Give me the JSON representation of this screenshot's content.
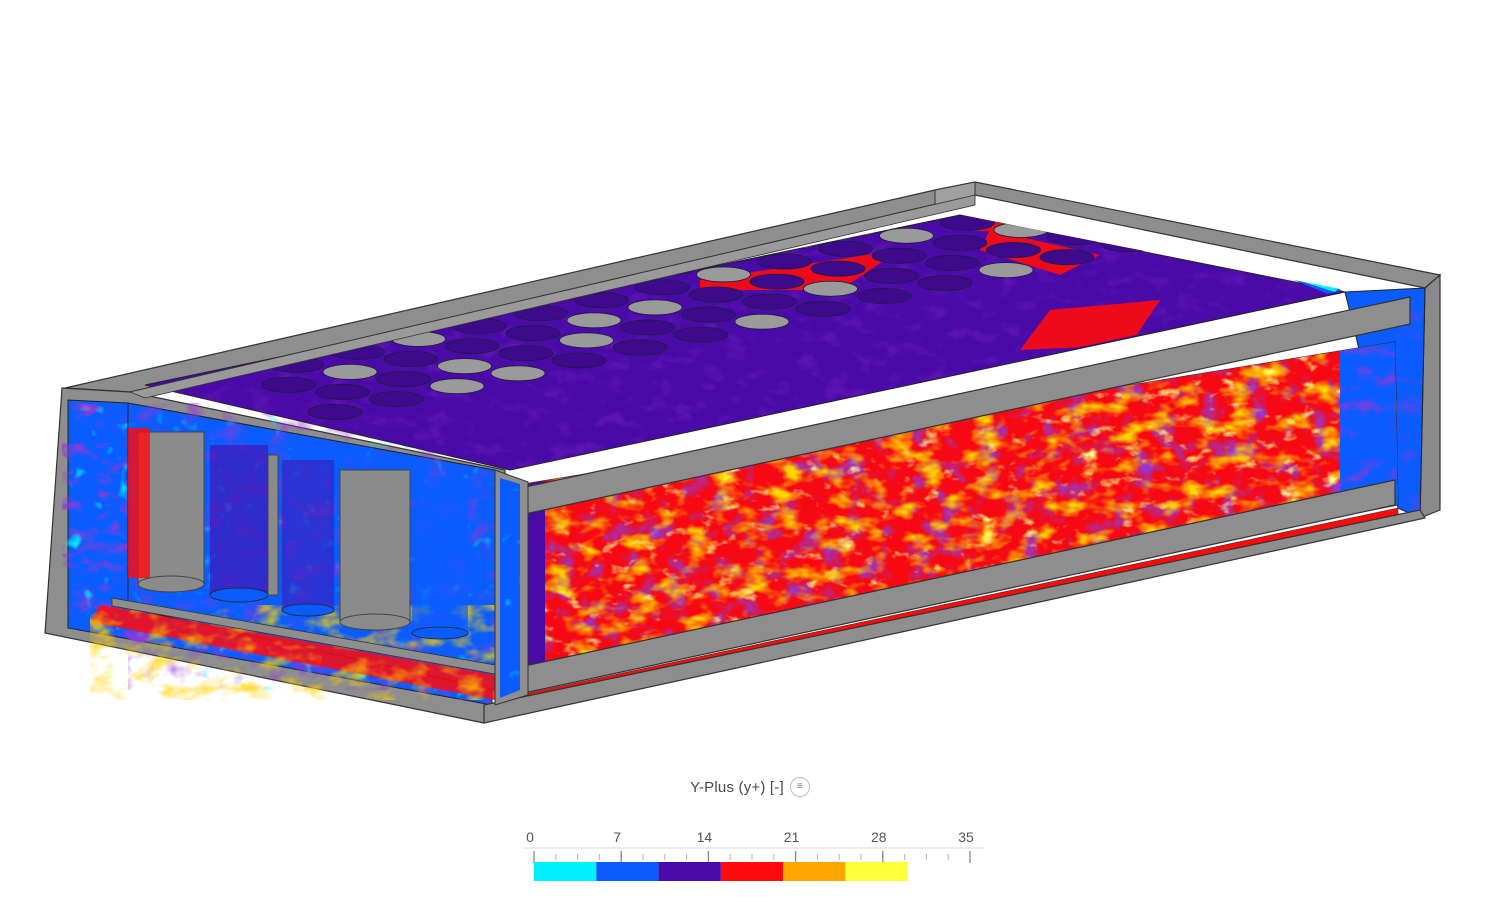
{
  "legend": {
    "title": "Y-Plus (y+) [-]",
    "menu_icon": "menu-icon",
    "ticks": [
      "0",
      "7",
      "14",
      "21",
      "28",
      "35"
    ],
    "tick_values": [
      0,
      7,
      14,
      21,
      28,
      35
    ],
    "range": [
      0,
      35
    ],
    "bands": [
      {
        "from": 0,
        "to": 5,
        "color": "#00f0ff"
      },
      {
        "from": 5,
        "to": 10,
        "color": "#0a5cff"
      },
      {
        "from": 10,
        "to": 15,
        "color": "#4a0aa8"
      },
      {
        "from": 15,
        "to": 20,
        "color": "#ff0a0a"
      },
      {
        "from": 20,
        "to": 25,
        "color": "#ffa500"
      },
      {
        "from": 25,
        "to": 30,
        "color": "#ffff3c"
      }
    ]
  },
  "colors": {
    "frame_gray": "#8c8c8c",
    "frame_dark": "#5a5a5a",
    "background": "#ffffff"
  }
}
